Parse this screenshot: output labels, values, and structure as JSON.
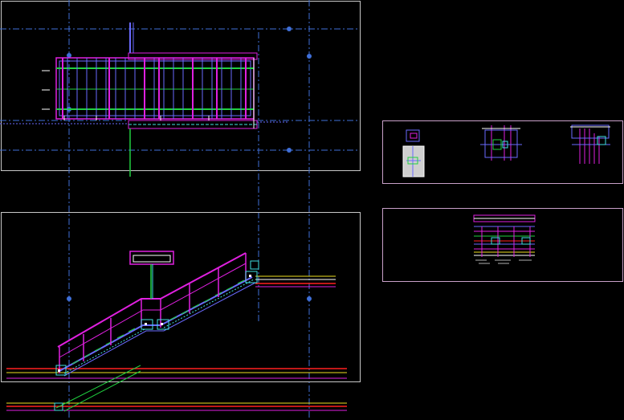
{
  "drawing": {
    "background": "#000000",
    "colors": {
      "frame": "#ffffff",
      "viewport_frame": "#c8a0c8",
      "axis": "#3f6fd8",
      "marker": "#3f6fd8",
      "structure": "#e020e0",
      "rail": "#20d040",
      "detail": "#40e0e0",
      "steel": "#6a6aff",
      "red": "#ff2020",
      "yellow": "#f0e020",
      "white": "#ffffff",
      "gray": "#b0b0b0"
    },
    "panels": {
      "plan": "stair-plan-view",
      "elevation": "stair-side-elevation",
      "details_top": "connection-details",
      "details_bottom": "section-detail"
    }
  }
}
